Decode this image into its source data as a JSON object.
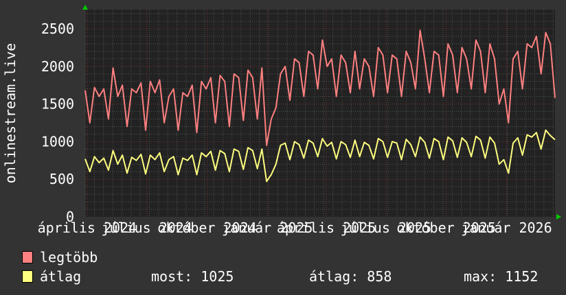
{
  "chart_data": {
    "type": "line",
    "ylabel": "onlinestream.live",
    "x_start": "2024-03-29",
    "x_end": "2026-03-16",
    "ylim": [
      0,
      2755
    ],
    "yticks": [
      0,
      500,
      1000,
      1500,
      2000,
      2500
    ],
    "xtick_labels": [
      "április 2024",
      "július 2024",
      "október 2024",
      "január 2025",
      "április 2025",
      "július 2025",
      "október 2025",
      "január 2026"
    ],
    "grid": true,
    "legend_placement": "bottom-left",
    "colors": {
      "background": "#333333",
      "plot": "#222222",
      "grid_minor": "#555555",
      "grid_major": "#7a3030",
      "axis_arrow": "#00cc00"
    },
    "series": [
      {
        "name": "legtöbb",
        "color": "#ff8080",
        "values": [
          1680,
          1250,
          1720,
          1600,
          1700,
          1300,
          1980,
          1600,
          1750,
          1200,
          1700,
          1650,
          1780,
          1150,
          1800,
          1650,
          1820,
          1250,
          1600,
          1700,
          1150,
          1650,
          1600,
          1750,
          1120,
          1800,
          1700,
          1850,
          1250,
          1880,
          1800,
          1200,
          1900,
          1850,
          1280,
          1950,
          1850,
          1300,
          1980,
          950,
          1300,
          1450,
          1900,
          2000,
          1550,
          2100,
          2050,
          1600,
          2200,
          2150,
          1700,
          2350,
          2000,
          2100,
          1600,
          2150,
          2050,
          1650,
          2200,
          1700,
          2100,
          2000,
          1600,
          2250,
          2150,
          1650,
          2150,
          2100,
          1600,
          2200,
          2050,
          1700,
          2480,
          2100,
          1650,
          2200,
          2150,
          1600,
          2300,
          2150,
          1650,
          2250,
          2100,
          1700,
          2350,
          2200,
          1650,
          2300,
          2100,
          1500,
          1700,
          1250,
          2100,
          2200,
          1700,
          2300,
          2250,
          2400,
          1900,
          2450,
          2300,
          1580
        ]
      },
      {
        "name": "átlag",
        "color": "#ffff80",
        "values": [
          770,
          600,
          800,
          720,
          780,
          620,
          880,
          700,
          820,
          580,
          790,
          750,
          830,
          570,
          820,
          760,
          850,
          600,
          760,
          800,
          560,
          780,
          750,
          820,
          560,
          850,
          800,
          870,
          620,
          880,
          840,
          600,
          900,
          870,
          630,
          920,
          880,
          640,
          900,
          470,
          560,
          700,
          950,
          980,
          760,
          1000,
          960,
          780,
          1020,
          980,
          800,
          1040,
          940,
          990,
          770,
          1000,
          960,
          790,
          1020,
          800,
          990,
          950,
          770,
          1040,
          1000,
          790,
          1000,
          980,
          760,
          1030,
          960,
          800,
          1060,
          990,
          780,
          1040,
          1000,
          760,
          1060,
          1010,
          790,
          1050,
          990,
          800,
          1070,
          1020,
          780,
          1060,
          980,
          700,
          760,
          580,
          980,
          1050,
          820,
          1090,
          1060,
          1120,
          900,
          1152,
          1080,
          1025
        ]
      }
    ],
    "legend": {
      "max_label": "legtöbb",
      "avg_label": "átlag",
      "now": "most: 1025",
      "average": "átlag: 858",
      "maximum": "max: 1152"
    }
  }
}
